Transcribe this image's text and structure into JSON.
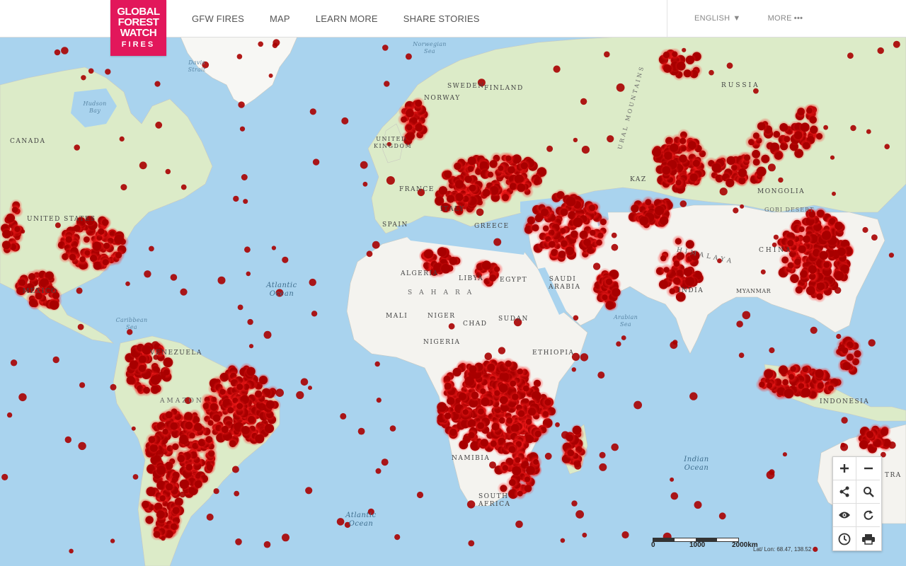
{
  "header": {
    "logo_lines": [
      "GLOBAL",
      "FOREST",
      "WATCH",
      "FIRES"
    ],
    "nav": [
      "GFW FIRES",
      "MAP",
      "LEARN MORE",
      "SHARE STORIES"
    ],
    "language": "ENGLISH",
    "more": "MORE"
  },
  "map": {
    "labels": {
      "canada": "CANADA",
      "united_states": "UNITED STATES",
      "mexico": "MEXICO",
      "venezuela": "VENEZUELA",
      "amazon": "AMAZON",
      "finland": "FINLAND",
      "sweden": "SWEDEN",
      "norway": "NORWAY",
      "united_kingdom": "UNITED KINGDOM",
      "france": "FRANCE",
      "spain": "SPAIN",
      "italy": "ITALY",
      "greece": "GREECE",
      "algeria": "ALGERIA",
      "libya": "LIBYA",
      "egypt": "EGYPT",
      "sahara": "SAHARA",
      "mali": "MALI",
      "niger": "NIGER",
      "chad": "CHAD",
      "sudan": "SUDAN",
      "nigeria": "NIGERIA",
      "ethiopia": "ETHIOPIA",
      "namibia": "NAMIBIA",
      "south_africa": "SOUTH AFRICA",
      "saudi_arabia": "SAUDI ARABIA",
      "russia": "RUSSIA",
      "kazakhstan": "KAZ",
      "mongolia": "MONGOLIA",
      "gobi": "GOBI DESERT",
      "china": "CHINA",
      "himalaya": "HIMALAYA",
      "india": "INDIA",
      "myanmar": "MYANMAR",
      "indonesia": "INDONESIA",
      "australia": "TRA",
      "ural": "URAL MOUNTAINS"
    },
    "oceans": {
      "atlantic_n": "Atlantic Ocean",
      "atlantic_s": "Atlantic Ocean",
      "indian": "Indian Ocean",
      "arabian_sea": "Arabian Sea",
      "caribbean": "Caribbean Sea",
      "norwegian": "Norwegian Sea",
      "davis": "Davis Strait",
      "hudson": "Hudson Bay"
    },
    "fire_color": "#a80000",
    "land_color": "#f4f3ef",
    "vegetation_color": "#dcebc8",
    "ocean_color": "#a9d3ee"
  },
  "controls": {
    "icons": [
      "zoom-in-icon",
      "zoom-out-icon",
      "share-icon",
      "search-icon",
      "eye-icon",
      "refresh-icon",
      "clock-icon",
      "print-icon"
    ]
  },
  "scale": {
    "ticks": [
      "0",
      "1000",
      "2000km"
    ]
  },
  "coordinates": "Lat/ Lon: 68.47, 138.52"
}
